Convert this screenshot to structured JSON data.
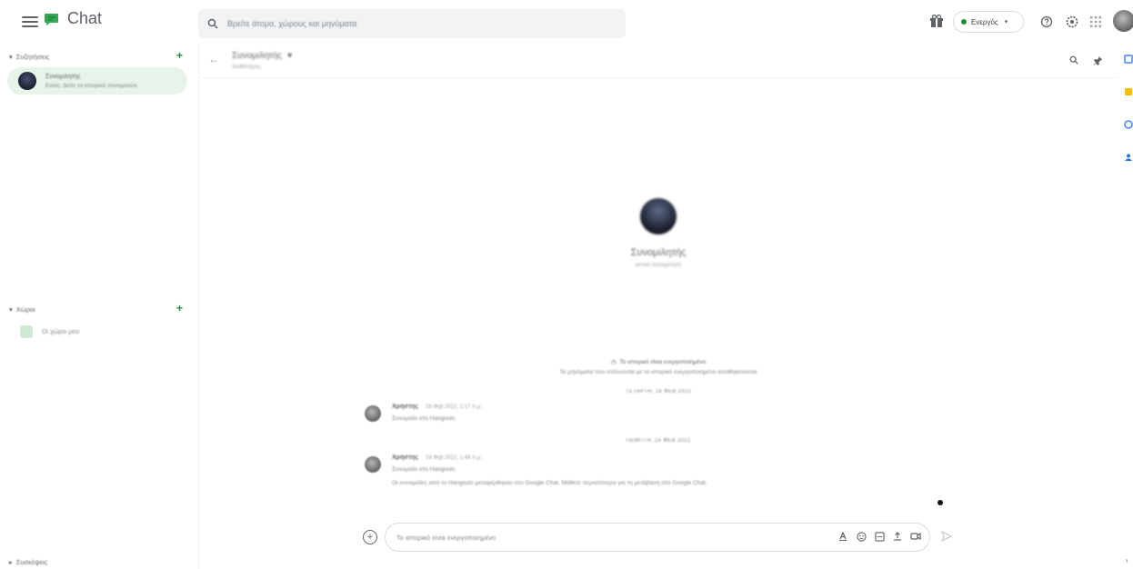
{
  "app": {
    "name": "Chat"
  },
  "search": {
    "placeholder": "Βρείτε άτομα, χώρους και μηνύματα"
  },
  "status": {
    "label": "Ενεργός"
  },
  "sidebar": {
    "dm_section": "Συζητήσεις",
    "dm_items": [
      {
        "name": "Συνομιλητής",
        "preview": "Εσείς: Δείτε το ιστορικό συνομιλιών"
      }
    ],
    "spaces_section": "Χώροι",
    "spaces_items": [
      {
        "name": "Οι χώροι μου"
      }
    ],
    "meetings_section": "Συσκέψεις"
  },
  "chat": {
    "header_name": "Συνομιλητής",
    "header_sub": "Διαθέσιμος",
    "intro_name": "Συνομιλητής",
    "intro_sub": "email συνομιλητή",
    "notice_line1": "Το ιστορικό είναι ενεργοποιημένο",
    "notice_line2": "Τα μηνύματα που στέλνονται με το ιστορικό ενεργοποιημένο αποθηκεύονται",
    "date_1": "ΤΕΤΑΡΤΗ, 16 ΦΕΒ 2022",
    "date_2": "ΠΕΜΠΤΗ, 24 ΦΕΒ 2022",
    "messages": [
      {
        "sender": "Χρήστης",
        "time": "16 Φεβ 2022, 1:17 π.μ.",
        "text": "Συνομιλία στο Hangouts"
      },
      {
        "sender": "Χρήστης",
        "time": "24 Φεβ 2022, 1:48 π.μ.",
        "text": "Συνομιλία στο Hangouts",
        "text2": "Οι συνομιλίες από το Hangouts μεταφέρθηκαν στο Google Chat. Μάθετε περισσότερα για τη μετάβαση στο Google Chat."
      }
    ]
  },
  "composer": {
    "placeholder": "Το ιστορικό είναι ενεργοποιημένο"
  },
  "colors": {
    "accent": "#1e8e3e",
    "selected_bg": "#e6f4ea",
    "search_bg": "#f1f3f4"
  }
}
